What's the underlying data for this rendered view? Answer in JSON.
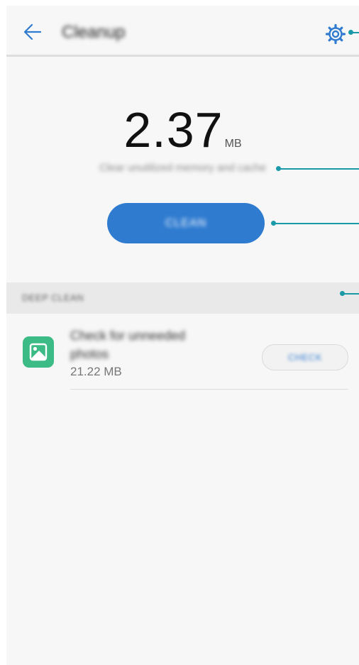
{
  "header": {
    "title": "Cleanup",
    "back_icon": "arrow-left-icon",
    "settings_icon": "gear-icon"
  },
  "summary": {
    "size_value": "2.37",
    "size_unit": "MB",
    "subtitle": "Clear unutilized memory and cache"
  },
  "actions": {
    "clean_label": "CLEAN"
  },
  "deep_clean": {
    "section_title": "DEEP CLEAN",
    "items": [
      {
        "icon": "image-icon",
        "title": "Check for unneeded photos",
        "size": "21.22 MB",
        "button_label": "CHECK"
      }
    ]
  },
  "colors": {
    "accent": "#2f7bd0",
    "icon_green": "#3dbb86",
    "callout": "#1a9aa8"
  }
}
